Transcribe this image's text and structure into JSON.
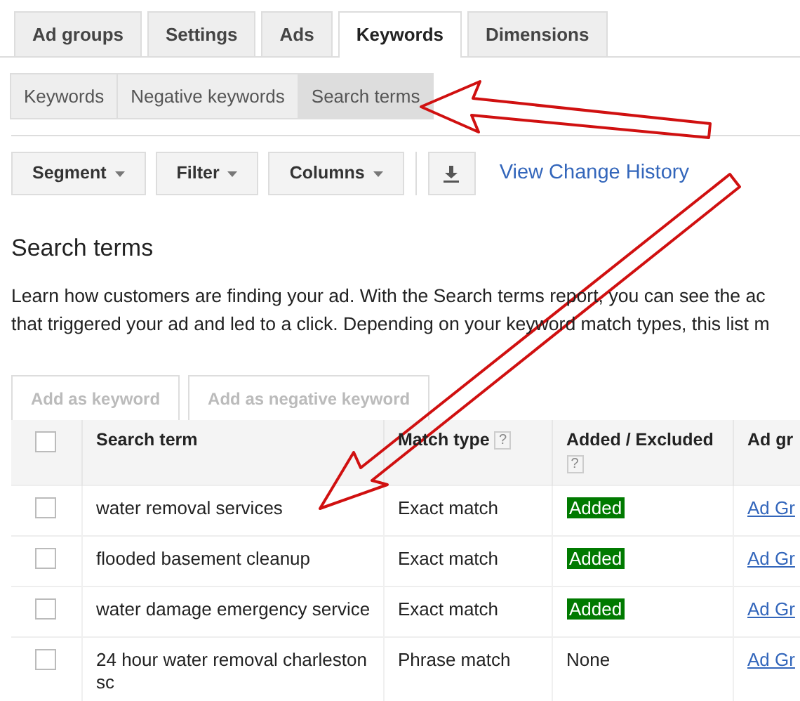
{
  "tabs": [
    {
      "label": "Ad groups",
      "selected": false
    },
    {
      "label": "Settings",
      "selected": false
    },
    {
      "label": "Ads",
      "selected": false
    },
    {
      "label": "Keywords",
      "selected": true
    },
    {
      "label": "Dimensions",
      "selected": false
    }
  ],
  "subtabs": [
    {
      "label": "Keywords",
      "selected": false
    },
    {
      "label": "Negative keywords",
      "selected": false
    },
    {
      "label": "Search terms",
      "selected": true
    }
  ],
  "toolbar": {
    "dropdowns": [
      "Segment",
      "Filter",
      "Columns"
    ],
    "link": "View Change History"
  },
  "heading": "Search terms",
  "description": [
    "Learn how customers are finding your ad. With the Search terms report, you can see the ac",
    "that triggered your ad and led to a click. Depending on your keyword match types, this list m"
  ],
  "actions": [
    {
      "label": "Add as keyword",
      "disabled": true
    },
    {
      "label": "Add as negative keyword",
      "disabled": true
    }
  ],
  "table": {
    "select_all": {
      "checked": false
    },
    "columns": [
      {
        "label": "Search term"
      },
      {
        "label": "Match type",
        "help": "?"
      },
      {
        "label": "Added / Excluded",
        "help": "?"
      },
      {
        "label": "Ad gr"
      }
    ],
    "rows": [
      {
        "checked": false,
        "search_term": "water removal services",
        "match_type": "Exact match",
        "status": {
          "text": "Added",
          "kind": "badge"
        },
        "ad_group": "Ad Gr"
      },
      {
        "checked": false,
        "search_term": "flooded basement cleanup",
        "match_type": "Exact match",
        "status": {
          "text": "Added",
          "kind": "badge"
        },
        "ad_group": "Ad Gr"
      },
      {
        "checked": false,
        "search_term": "water damage emergency service",
        "match_type": "Exact match",
        "status": {
          "text": "Added",
          "kind": "badge"
        },
        "ad_group": "Ad Gr"
      },
      {
        "checked": false,
        "search_term": "24 hour water removal charleston sc",
        "match_type": "Phrase match",
        "status": {
          "text": "None",
          "kind": "plain"
        },
        "ad_group": "Ad Gr"
      }
    ]
  },
  "annotations": [
    {
      "kind": "arrow"
    },
    {
      "kind": "arrow"
    }
  ]
}
